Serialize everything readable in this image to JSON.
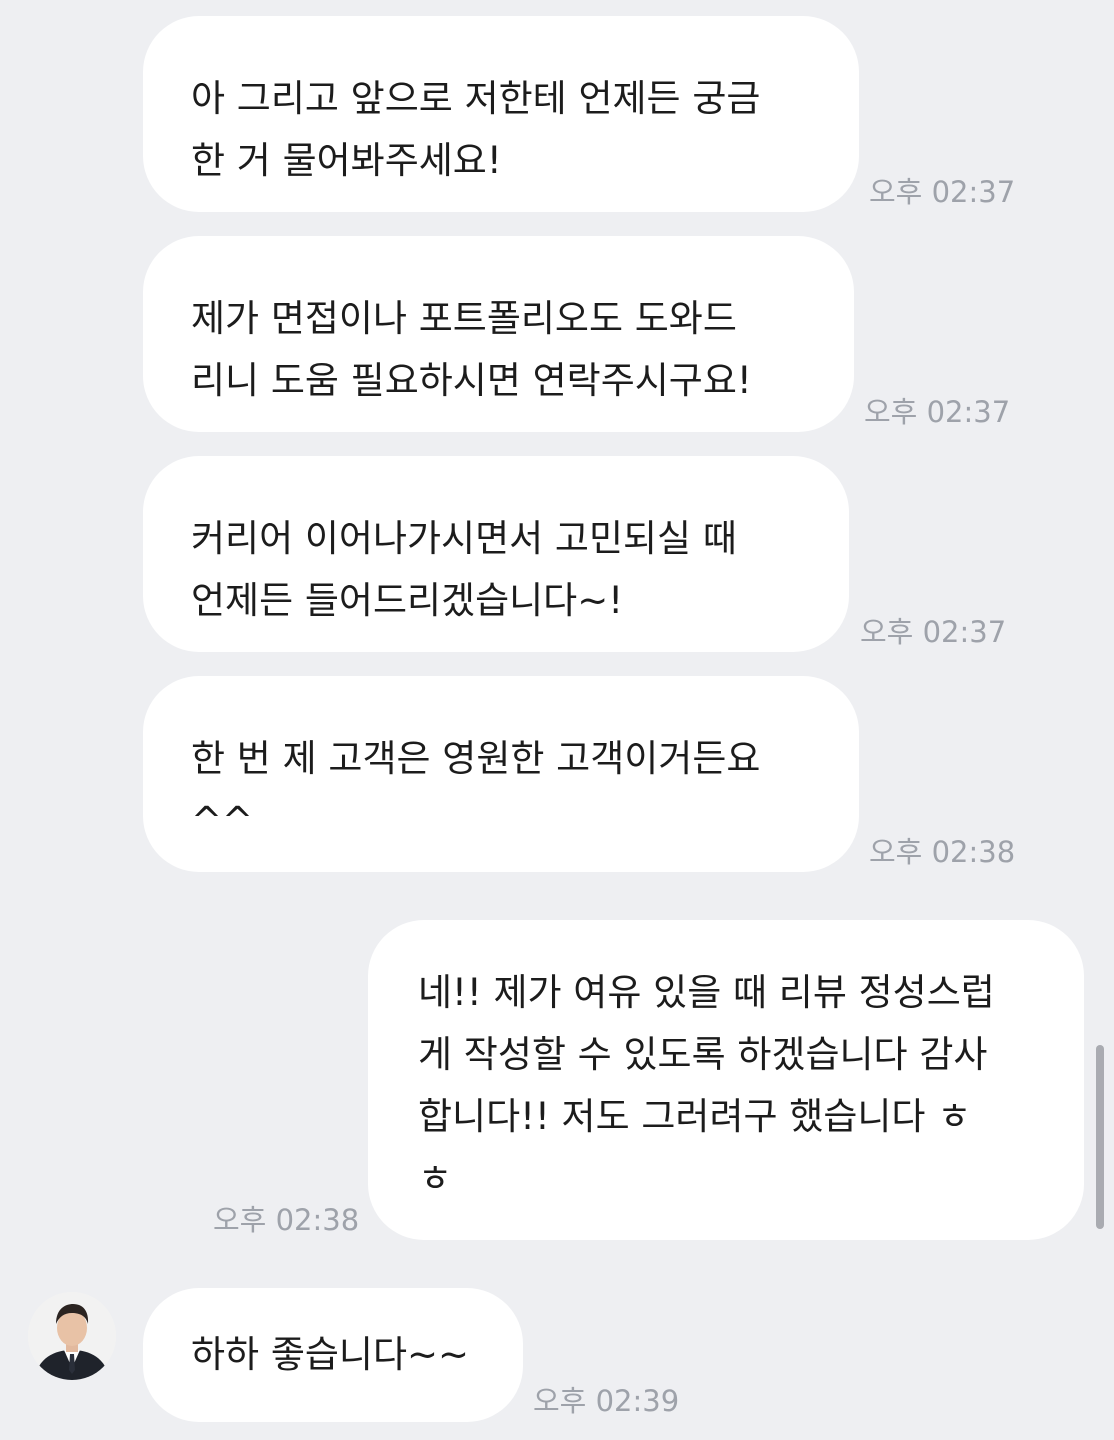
{
  "messages": [
    {
      "sender": "other",
      "lines": [
        "아 그리고 앞으로 저한테 언제든 궁금",
        "한 거 물어봐주세요!"
      ],
      "time": "오후 02:37"
    },
    {
      "sender": "other",
      "lines": [
        "제가 면접이나 포트폴리오도 도와드",
        "리니 도움 필요하시면 연락주시구요!"
      ],
      "time": "오후 02:37"
    },
    {
      "sender": "other",
      "lines": [
        "커리어 이어나가시면서 고민되실 때",
        "언제든 들어드리겠습니다~!"
      ],
      "time": "오후 02:37"
    },
    {
      "sender": "other",
      "lines": [
        "한 번 제 고객은 영원한 고객이거든요",
        "^^"
      ],
      "time": "오후 02:38"
    },
    {
      "sender": "me",
      "lines": [
        "네!! 제가 여유 있을 때 리뷰 정성스럽",
        "게 작성할 수 있도록 하겠습니다 감사",
        "합니다!! 저도 그러려구 했습니다 ㅎ",
        "ㅎ"
      ],
      "time": "오후 02:38"
    },
    {
      "sender": "other",
      "lines": [
        "하하 좋습니다~~"
      ],
      "time": "오후 02:39"
    }
  ],
  "colors": {
    "background": "#eeeff2",
    "bubble": "#ffffff",
    "text": "#1c1c1c",
    "timestamp": "#9ea2aa"
  },
  "icons": {
    "avatar": "profile-photo-avatar"
  }
}
